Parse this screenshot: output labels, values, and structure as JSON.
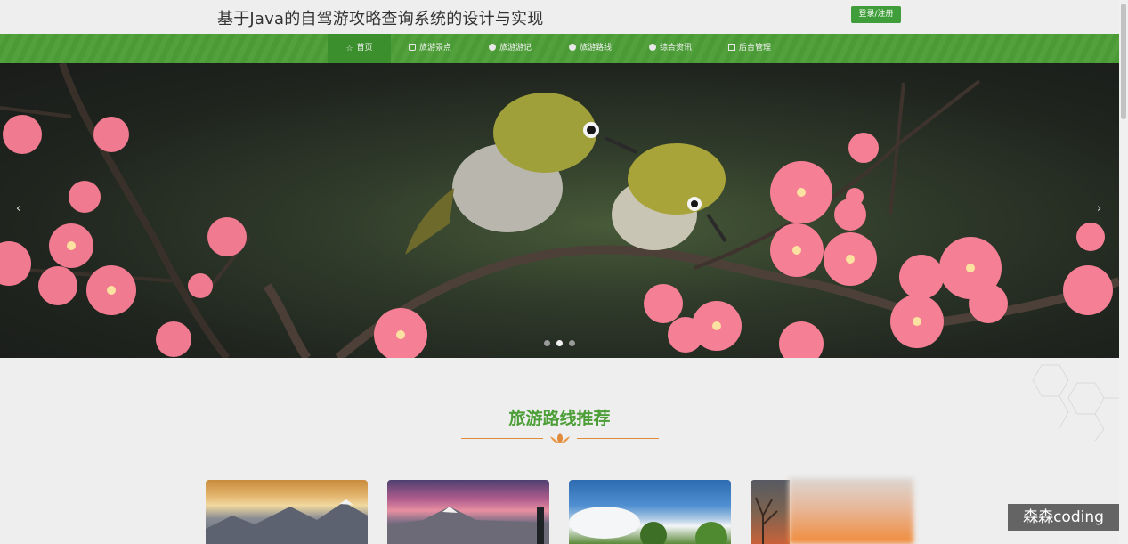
{
  "header": {
    "title": "基于Java的自驾游攻略查询系统的设计与实现",
    "login_label": "登录/注册"
  },
  "nav": {
    "items": [
      {
        "label": "首页",
        "icon": "star-icon"
      },
      {
        "label": "旅游景点",
        "icon": "bag-icon"
      },
      {
        "label": "旅游游记",
        "icon": "info-icon"
      },
      {
        "label": "旅游路线",
        "icon": "info-icon"
      },
      {
        "label": "综合资讯",
        "icon": "info-icon"
      },
      {
        "label": "后台管理",
        "icon": "book-icon"
      }
    ],
    "active_index": 0
  },
  "carousel": {
    "prev_label": "‹",
    "next_label": "›",
    "slide_count": 3,
    "active_slide": 1
  },
  "recommend": {
    "title": "旅游路线推荐"
  },
  "watermark": "森森coding",
  "colors": {
    "nav_green": "#4c9e37",
    "title_green": "#4c9e37",
    "accent_orange": "#e08a3a"
  }
}
